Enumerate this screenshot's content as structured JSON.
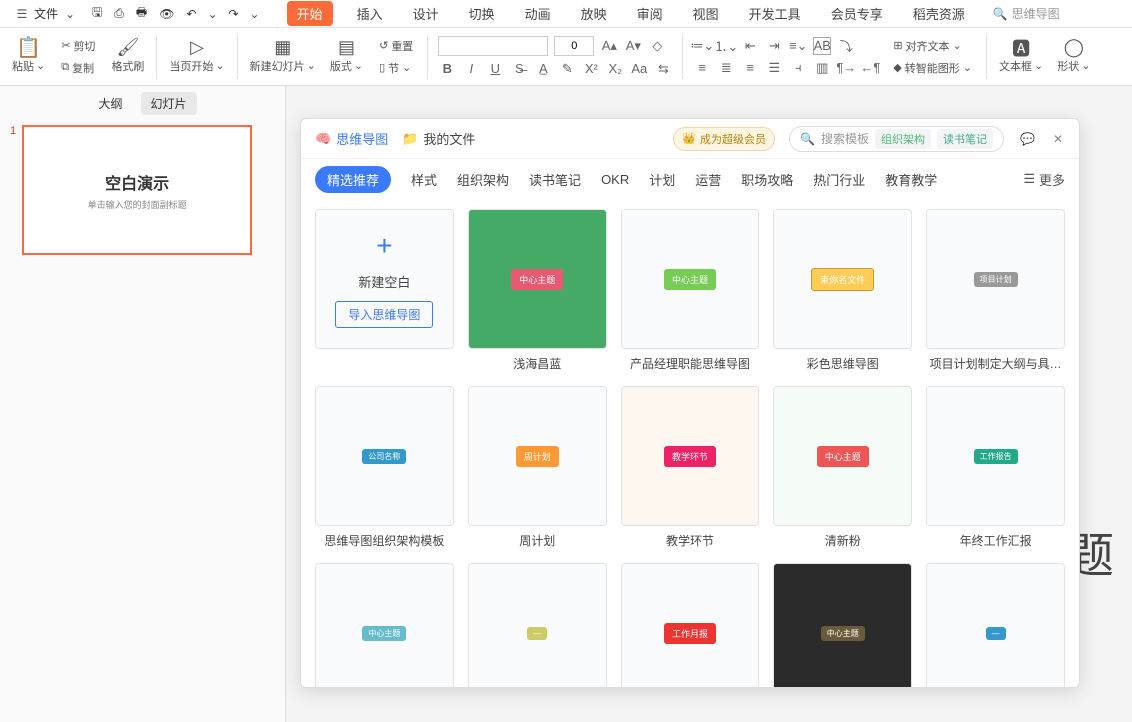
{
  "topbar": {
    "file_label": "文件",
    "menu": [
      "开始",
      "插入",
      "设计",
      "切换",
      "动画",
      "放映",
      "审阅",
      "视图",
      "开发工具",
      "会员专享",
      "稻壳资源"
    ],
    "active_menu": 0,
    "search_placeholder": "思维导图"
  },
  "ribbon": {
    "paste": "粘贴",
    "cut": "剪切",
    "copy": "复制",
    "format_painter": "格式刷",
    "from_current": "当页开始",
    "new_slide": "新建幻灯片",
    "layout": "版式",
    "reset": "重置",
    "section": "节",
    "font_name": "",
    "font_size": "0",
    "align_text": "对齐文本",
    "smart_graphic": "转智能图形",
    "text_box": "文本框",
    "shape": "形状"
  },
  "leftpane": {
    "view_outline": "大纲",
    "view_slides": "幻灯片",
    "slide_number": "1",
    "slide_title": "空白演示",
    "slide_sub": "单击输入您的封面副标题"
  },
  "canvas": {
    "peek_text": "题"
  },
  "mindmap": {
    "tab_mindmap": "思维导图",
    "tab_myfiles": "我的文件",
    "vip_label": "成为超级会员",
    "search_placeholder": "搜索模板",
    "quick_tags": [
      "组织架构",
      "读书笔记"
    ],
    "categories": [
      "精选推荐",
      "样式",
      "组织架构",
      "读书笔记",
      "OKR",
      "计划",
      "运营",
      "职场攻略",
      "热门行业",
      "教育教学"
    ],
    "active_cat": 0,
    "more_label": "更多",
    "new_blank_label": "新建空白",
    "import_label": "导入思维导图",
    "templates_row1": [
      "浅海昌蓝",
      "产品经理职能思维导图",
      "彩色思维导图",
      "项目计划制定大纲与具…"
    ],
    "templates_row2": [
      "思维导图组织架构模板",
      "周计划",
      "教学环节",
      "清新粉",
      "年终工作汇报"
    ]
  }
}
